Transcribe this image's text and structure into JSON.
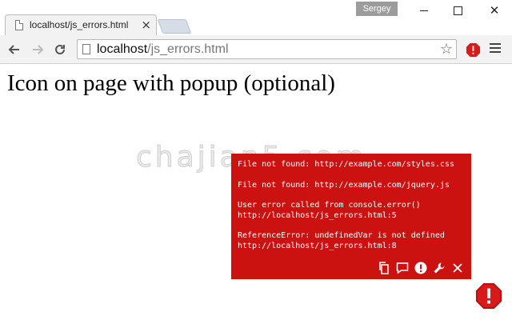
{
  "window": {
    "profile_name": "Sergey"
  },
  "tabs": [
    {
      "title": "localhost/js_errors.html"
    }
  ],
  "toolbar": {
    "url_host": "localhost",
    "url_path": "/js_errors.html"
  },
  "page": {
    "heading": "Icon on page with popup (optional)",
    "watermark": "chajian5.com"
  },
  "popup": {
    "background_color": "#cc1111",
    "messages": [
      "File not found: http://example.com/styles.css",
      "File not found: http://example.com/jquery.js",
      "User error called from console.error()\nhttp://localhost/js_errors.html:5",
      "ReferenceError: undefinedVar is not defined\nhttp://localhost/js_errors.html:8"
    ],
    "actions": [
      "copy-icon",
      "comment-icon",
      "exclamation-icon",
      "wrench-icon",
      "close-icon"
    ]
  },
  "colors": {
    "error_red": "#cc1111",
    "badge_red": "#d71a1a"
  }
}
